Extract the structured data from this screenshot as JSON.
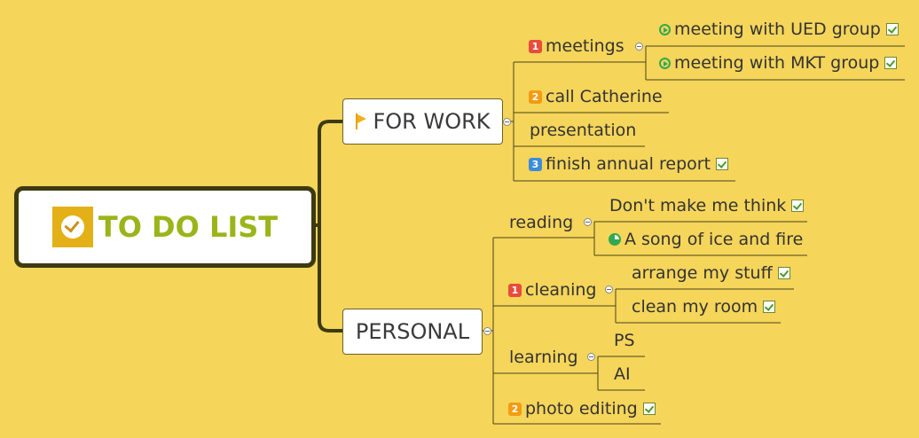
{
  "root": {
    "title": "TO DO LIST",
    "icon": "check-logo-icon"
  },
  "branches": {
    "work": {
      "label": "FOR WORK",
      "icon": "flag-icon",
      "children": {
        "meetings": {
          "label": "meetings",
          "priority": "1",
          "children": [
            {
              "label": "meeting with UED group",
              "icon": "play-icon",
              "task": true
            },
            {
              "label": "meeting with MKT group",
              "icon": "play-icon",
              "task": true
            }
          ]
        },
        "call": {
          "label": "call Catherine",
          "priority": "2"
        },
        "presentation": {
          "label": "presentation"
        },
        "report": {
          "label": "finish annual report",
          "priority": "3",
          "task": true
        }
      }
    },
    "personal": {
      "label": "PERSONAL",
      "children": {
        "reading": {
          "label": "reading",
          "children": [
            {
              "label": "Don't make me think",
              "task": true
            },
            {
              "label": "A song of ice and fire",
              "icon": "pie-progress-icon"
            }
          ]
        },
        "cleaning": {
          "label": "cleaning",
          "priority": "1",
          "children": [
            {
              "label": "arrange my stuff",
              "task": true
            },
            {
              "label": "clean my room",
              "task": true
            }
          ]
        },
        "learning": {
          "label": "learning",
          "children": [
            {
              "label": "PS"
            },
            {
              "label": "AI"
            }
          ]
        },
        "photo": {
          "label": "photo editing",
          "priority": "2",
          "task": true
        }
      }
    }
  },
  "colors": {
    "background": "#f5d55a",
    "root_title": "#9ab51a",
    "connector": "#3d3a12",
    "priority_1": "#e74c3c",
    "priority_2": "#f39c12",
    "priority_3": "#3c8cdc"
  }
}
